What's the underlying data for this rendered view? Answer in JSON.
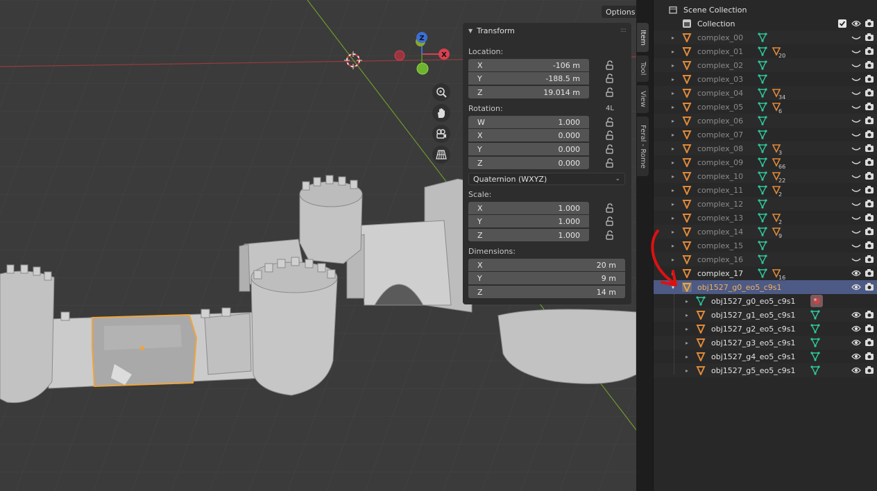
{
  "viewport": {
    "options_label": "Options"
  },
  "transform": {
    "title": "Transform",
    "location": {
      "label": "Location:",
      "x_label": "X",
      "x": "-106 m",
      "y_label": "Y",
      "y": "-188.5 m",
      "z_label": "Z",
      "z": "19.014 m"
    },
    "rotation": {
      "label": "Rotation:",
      "mode": "4L",
      "w_label": "W",
      "w": "1.000",
      "x_label": "X",
      "x": "0.000",
      "y_label": "Y",
      "y": "0.000",
      "z_label": "Z",
      "z": "0.000",
      "rotation_mode": "Quaternion (WXYZ)"
    },
    "scale": {
      "label": "Scale:",
      "x_label": "X",
      "x": "1.000",
      "y_label": "Y",
      "y": "1.000",
      "z_label": "Z",
      "z": "1.000"
    },
    "dimensions": {
      "label": "Dimensions:",
      "x_label": "X",
      "x": "20 m",
      "y_label": "Y",
      "y": "9 m",
      "z_label": "Z",
      "z": "14 m"
    }
  },
  "tabs": [
    "Item",
    "Tool",
    "View",
    "Feral - Rome"
  ],
  "gizmo": {
    "z": "Z",
    "x": "X"
  },
  "outliner": {
    "scene_collection": "Scene Collection",
    "collection": "Collection",
    "objects": [
      {
        "name": "complex_00",
        "count": ""
      },
      {
        "name": "complex_01",
        "count": "20"
      },
      {
        "name": "complex_02",
        "count": ""
      },
      {
        "name": "complex_03",
        "count": ""
      },
      {
        "name": "complex_04",
        "count": "34"
      },
      {
        "name": "complex_05",
        "count": "6"
      },
      {
        "name": "complex_06",
        "count": ""
      },
      {
        "name": "complex_07",
        "count": ""
      },
      {
        "name": "complex_08",
        "count": "3"
      },
      {
        "name": "complex_09",
        "count": "66"
      },
      {
        "name": "complex_10",
        "count": "22"
      },
      {
        "name": "complex_11",
        "count": "2"
      },
      {
        "name": "complex_12",
        "count": ""
      },
      {
        "name": "complex_13",
        "count": "2"
      },
      {
        "name": "complex_14",
        "count": "9"
      },
      {
        "name": "complex_15",
        "count": ""
      },
      {
        "name": "complex_16",
        "count": ""
      },
      {
        "name": "complex_17",
        "count": "16"
      }
    ],
    "selected_object": "obj1527_g0_eo5_c9s1",
    "children": [
      "obj1527_g0_eo5_c9s1",
      "obj1527_g1_eo5_c9s1",
      "obj1527_g2_eo5_c9s1",
      "obj1527_g3_eo5_c9s1",
      "obj1527_g4_eo5_c9s1",
      "obj1527_g5_eo5_c9s1"
    ]
  },
  "colors": {
    "viewport_bg": "#3b3b3b",
    "selection_outline": "#f0a43c",
    "annotation_red": "#e01010",
    "selected_row": "#4c5a85",
    "mesh_icon": "#2fc89a",
    "object_icon": "#e08a3a"
  }
}
